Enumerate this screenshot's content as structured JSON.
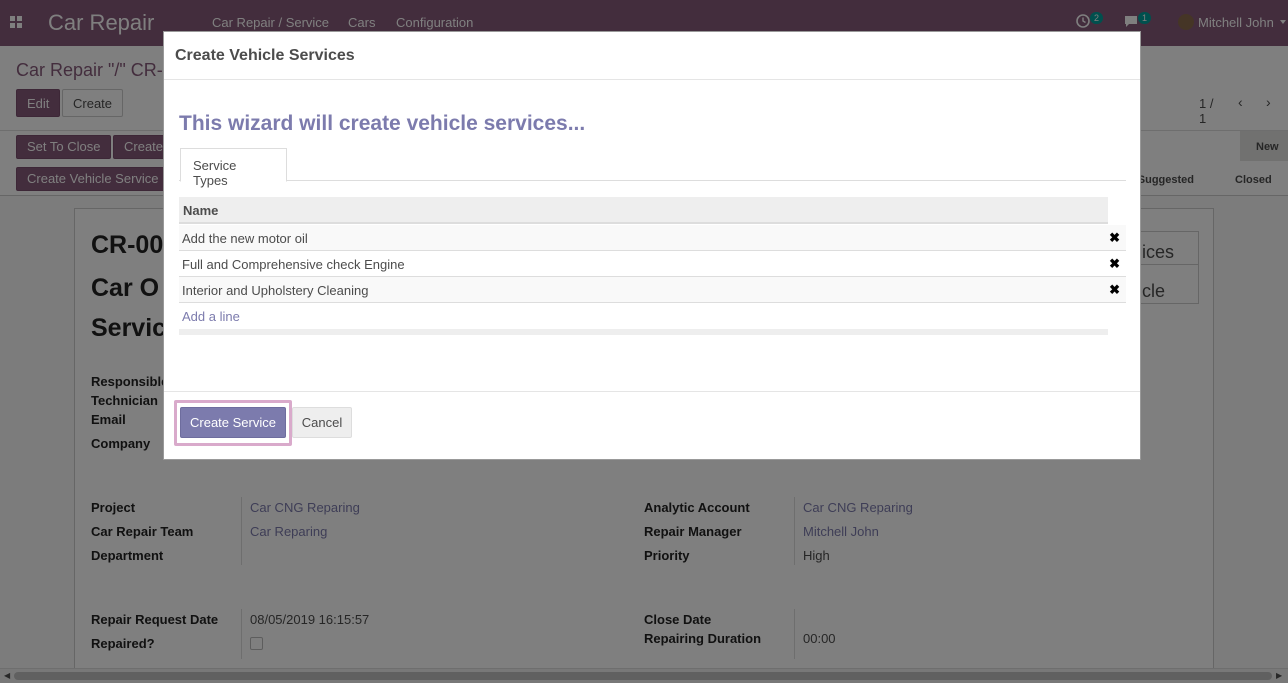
{
  "navbar": {
    "brand": "Car Repair",
    "menu": [
      "Car Repair / Service",
      "Cars",
      "Configuration"
    ],
    "activity_count": "2",
    "messages_count": "1",
    "user_name": "Mitchell John"
  },
  "control_panel": {
    "breadcrumb": "Car Repair \"/\" CR-",
    "edit_label": "Edit",
    "create_label": "Create",
    "pager": "1 / 1"
  },
  "statusbar": {
    "buttons": [
      "Set To Close",
      "Create",
      "Create Vehicle Service"
    ],
    "stages": [
      "New",
      "n Suggested",
      "Closed"
    ]
  },
  "sheet": {
    "ref": "CR-00",
    "title_line1": "Car O",
    "title_line2": "Servic",
    "smart_buttons": [
      "ices",
      "cle"
    ],
    "left_labels": [
      "Responsible",
      "Technician",
      "Email",
      "Company"
    ],
    "project_label": "Project",
    "project_value": "Car CNG Reparing",
    "team_label": "Car Repair Team",
    "team_value": "Car Reparing",
    "department_label": "Department",
    "analytic_label": "Analytic Account",
    "analytic_value": "Car CNG Reparing",
    "manager_label": "Repair Manager",
    "manager_value": "Mitchell John",
    "priority_label": "Priority",
    "priority_value": "High",
    "request_date_label": "Repair Request Date",
    "request_date_value": "08/05/2019 16:15:57",
    "repaired_label": "Repaired?",
    "close_date_label": "Close Date",
    "duration_label": "Repairing Duration",
    "duration_value": "00:00"
  },
  "modal": {
    "title": "Create Vehicle Services",
    "heading": "This wizard will create vehicle services...",
    "tab_label": "Service Types",
    "column_name": "Name",
    "rows": [
      "Add the new motor oil",
      "Full and Comprehensive check Engine",
      "Interior and Upholstery Cleaning"
    ],
    "add_line": "Add a line",
    "create_service_label": "Create Service",
    "cancel_label": "Cancel"
  }
}
